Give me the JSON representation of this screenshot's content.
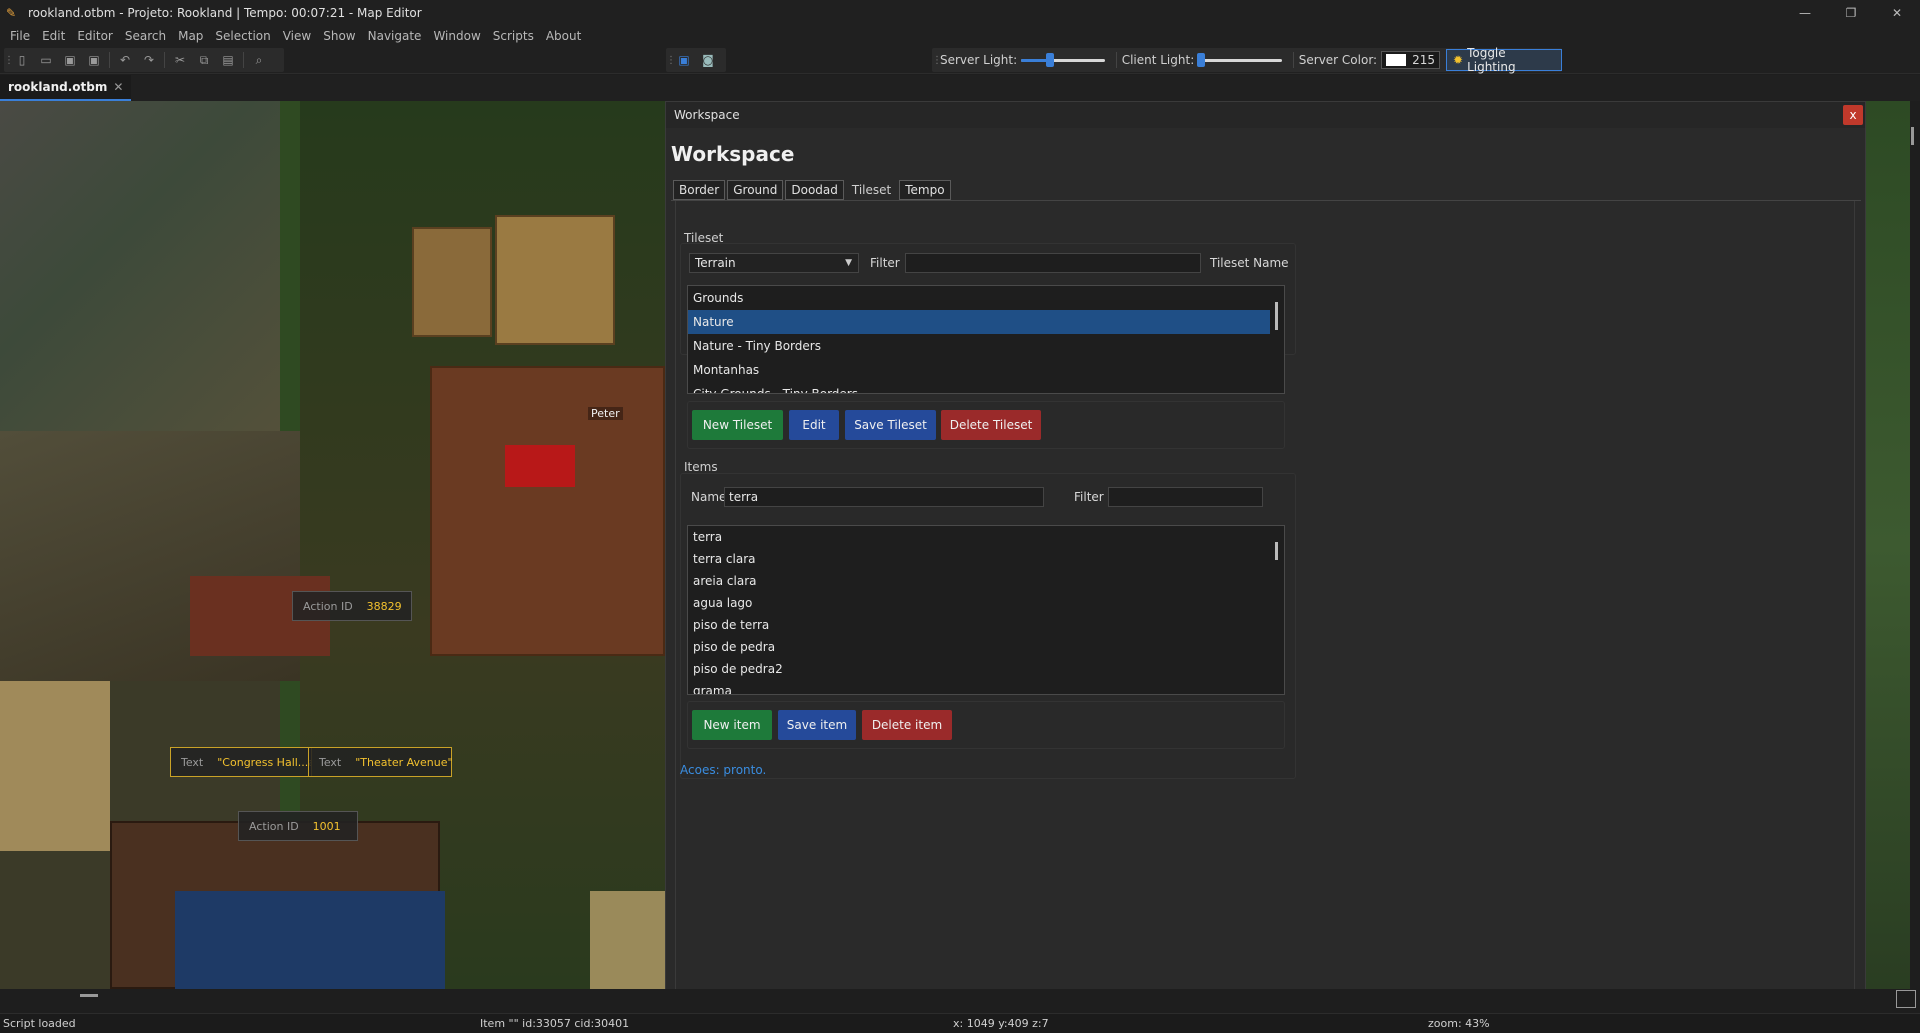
{
  "window": {
    "title": "rookland.otbm - Projeto: Rookland | Tempo: 00:07:21 - Map Editor",
    "controls": {
      "minimize": "—",
      "maximize": "❐",
      "close": "✕"
    }
  },
  "menu": [
    "File",
    "Edit",
    "Editor",
    "Search",
    "Map",
    "Selection",
    "View",
    "Show",
    "Navigate",
    "Window",
    "Scripts",
    "About"
  ],
  "toolbar": {
    "server_light_label": "Server Light:",
    "server_light_level": 0.35,
    "client_light_label": "Client Light:",
    "client_light_level": 0.03,
    "server_color_label": "Server Color:",
    "server_color_value": "215",
    "server_color_swatch": "#ffffff",
    "toggle_lighting_label": "Toggle Lighting"
  },
  "document_tab": {
    "label": "rookland.otbm",
    "close": "✕"
  },
  "map": {
    "peter": "Peter",
    "action1": {
      "label": "Action ID",
      "value": "38829"
    },
    "text1": {
      "label": "Text",
      "value": "\"Congress Hall...ar"
    },
    "text2": {
      "label": "Text",
      "value": "\"Theater Avenue\""
    },
    "action2": {
      "label": "Action ID",
      "value": "1001"
    }
  },
  "workspace": {
    "window_title": "Workspace",
    "close": "x",
    "heading": "Workspace",
    "tabs": [
      "Border",
      "Ground",
      "Doodad",
      "Tileset",
      "Tempo"
    ],
    "active_tab": "Tileset",
    "tileset": {
      "group_title": "Tileset",
      "category": "Terrain",
      "filter_label": "Filter",
      "filter_value": "",
      "name_label": "Tileset Name",
      "list": [
        "Grounds",
        "Nature",
        "Nature - Tiny Borders",
        "Montanhas",
        "City Grounds - Tiny Borders"
      ],
      "selected": "Nature",
      "buttons": {
        "new": "New Tileset",
        "edit": "Edit",
        "save": "Save Tileset",
        "delete": "Delete Tileset"
      }
    },
    "items": {
      "group_title": "Items",
      "name_label": "Name",
      "name_value": "terra",
      "filter_label": "Filter",
      "filter_value": "",
      "list": [
        "terra",
        "terra clara",
        "areia clara",
        "agua lago",
        "piso de terra",
        "piso de pedra",
        "piso de pedra2",
        "grama"
      ],
      "buttons": {
        "new": "New item",
        "save": "Save item",
        "delete": "Delete item"
      }
    },
    "status": "Acoes: pronto."
  },
  "statusbar": {
    "script": "Script loaded",
    "item": "Item \"\" id:33057 cid:30401",
    "position": "x: 1049 y:409 z:7",
    "zoom": "zoom: 43%"
  },
  "colors": {
    "accent": "#3a7fd8",
    "green": "#1e7a3a",
    "blue": "#254a9a",
    "red": "#9a2a2a"
  }
}
